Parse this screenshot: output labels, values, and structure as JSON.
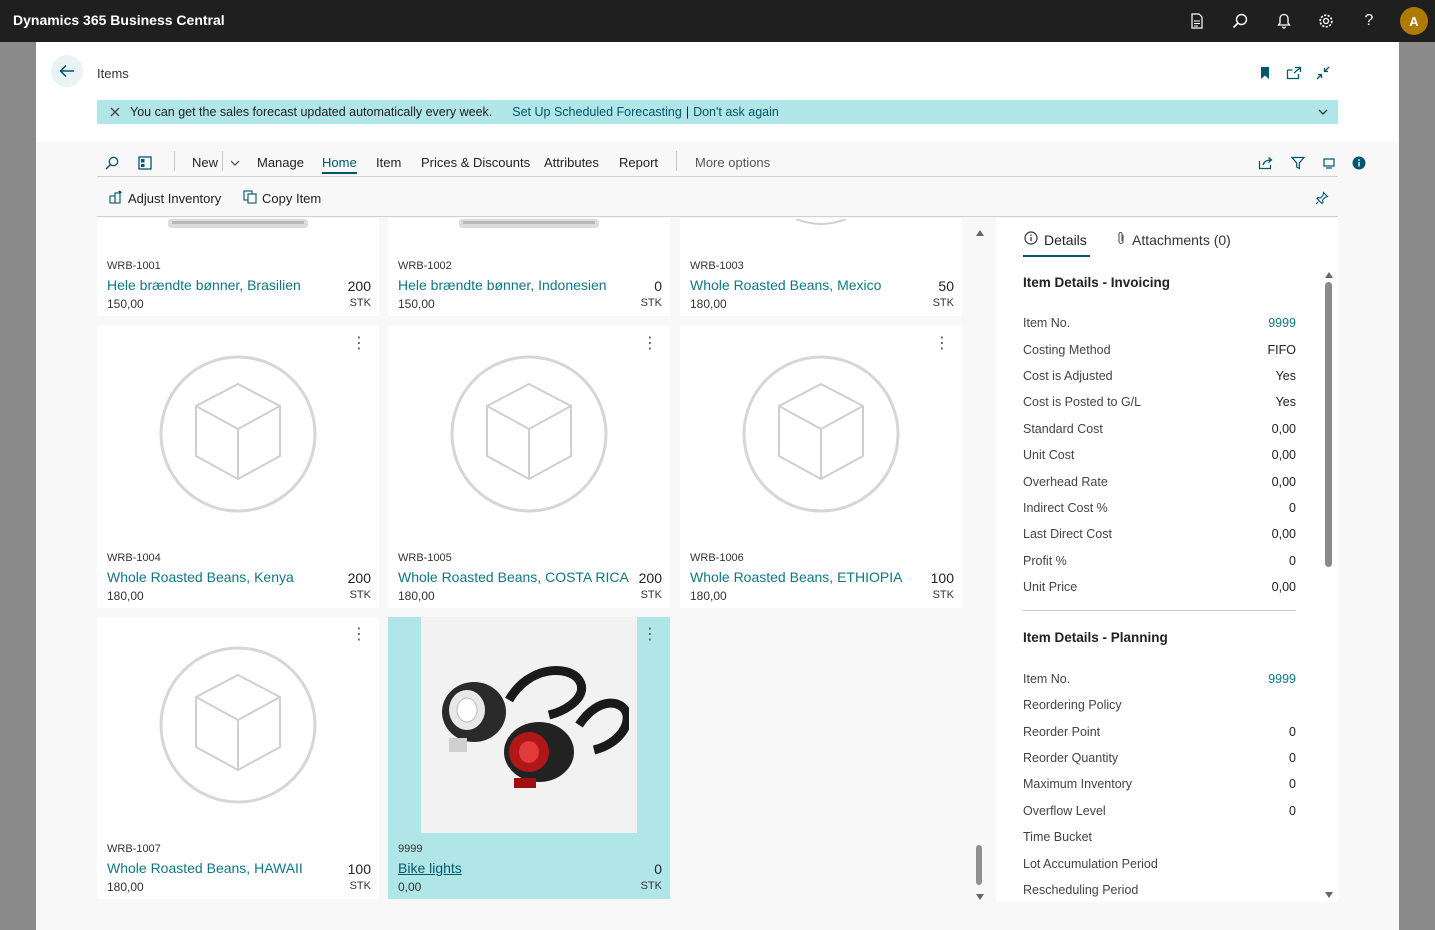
{
  "app": {
    "title": "Dynamics 365 Business Central",
    "avatar_initial": "A"
  },
  "topbar_icons": [
    "report-icon",
    "search-icon",
    "bell-icon",
    "settings-icon",
    "help-icon"
  ],
  "help_glyph": "?",
  "breadcrumb": "Items",
  "notification": {
    "message": "You can get the sales forecast updated automatically every week.",
    "link1": "Set Up Scheduled Forecasting",
    "separator": "|",
    "link2": "Don't ask again"
  },
  "actionbar": {
    "new": "New",
    "manage": "Manage",
    "home": "Home",
    "item": "Item",
    "prices": "Prices & Discounts",
    "attributes": "Attributes",
    "report": "Report",
    "more": "More options"
  },
  "subbar": {
    "adjust": "Adjust Inventory",
    "copy": "Copy Item"
  },
  "tiles": [
    {
      "no": "WRB-1001",
      "desc": "Hele brændte bønner, Brasilien",
      "price": "150,00",
      "qty": "200",
      "uom": "STK"
    },
    {
      "no": "WRB-1002",
      "desc": "Hele brændte bønner, Indonesien",
      "price": "150,00",
      "qty": "0",
      "uom": "STK"
    },
    {
      "no": "WRB-1003",
      "desc": "Whole Roasted Beans, Mexico",
      "price": "180,00",
      "qty": "50",
      "uom": "STK"
    },
    {
      "no": "WRB-1004",
      "desc": "Whole Roasted Beans, Kenya",
      "price": "180,00",
      "qty": "200",
      "uom": "STK"
    },
    {
      "no": "WRB-1005",
      "desc": "Whole Roasted Beans, COSTA RICA",
      "price": "180,00",
      "qty": "200",
      "uom": "STK"
    },
    {
      "no": "WRB-1006",
      "desc": "Whole Roasted Beans, ETHIOPIA",
      "price": "180,00",
      "qty": "100",
      "uom": "STK"
    },
    {
      "no": "WRB-1007",
      "desc": "Whole Roasted Beans, HAWAII",
      "price": "180,00",
      "qty": "100",
      "uom": "STK"
    },
    {
      "no": "9999",
      "desc": "Bike lights",
      "price": "0,00",
      "qty": "0",
      "uom": "STK",
      "selected": true
    }
  ],
  "factbox": {
    "tab_details": "Details",
    "tab_attachments": "Attachments (0)",
    "invoicing": {
      "title": "Item Details - Invoicing",
      "rows": [
        {
          "label": "Item No.",
          "value": "9999"
        },
        {
          "label": "Costing Method",
          "value": "FIFO"
        },
        {
          "label": "Cost is Adjusted",
          "value": "Yes"
        },
        {
          "label": "Cost is Posted to G/L",
          "value": "Yes"
        },
        {
          "label": "Standard Cost",
          "value": "0,00"
        },
        {
          "label": "Unit Cost",
          "value": "0,00"
        },
        {
          "label": "Overhead Rate",
          "value": "0,00"
        },
        {
          "label": "Indirect Cost %",
          "value": "0"
        },
        {
          "label": "Last Direct Cost",
          "value": "0,00"
        },
        {
          "label": "Profit %",
          "value": "0"
        },
        {
          "label": "Unit Price",
          "value": "0,00"
        }
      ]
    },
    "planning": {
      "title": "Item Details - Planning",
      "rows": [
        {
          "label": "Item No.",
          "value": "9999"
        },
        {
          "label": "Reordering Policy",
          "value": ""
        },
        {
          "label": "Reorder Point",
          "value": "0"
        },
        {
          "label": "Reorder Quantity",
          "value": "0"
        },
        {
          "label": "Maximum Inventory",
          "value": "0"
        },
        {
          "label": "Overflow Level",
          "value": "0"
        },
        {
          "label": "Time Bucket",
          "value": ""
        },
        {
          "label": "Lot Accumulation Period",
          "value": ""
        },
        {
          "label": "Rescheduling Period",
          "value": ""
        }
      ]
    }
  },
  "colors": {
    "accent": "#00576b",
    "link": "#0e7785",
    "notification_bg": "#b1e6e9",
    "topbar": "#1f1f1f",
    "avatar": "#ae7b00"
  }
}
